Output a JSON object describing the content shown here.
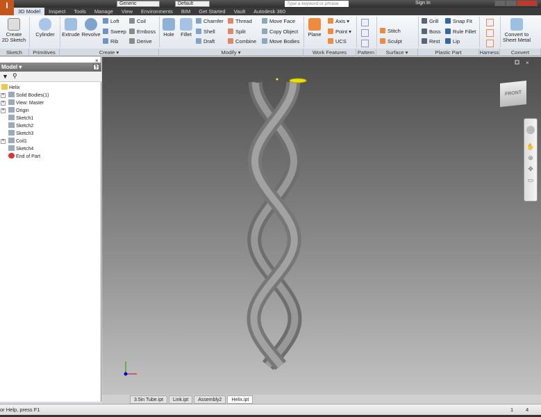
{
  "qat": {
    "material": "Generic",
    "appearance": "Default",
    "search_placeholder": "Type a keyword or phrase",
    "sign_in": "Sign In",
    "logo": "I",
    "logo_sub": "PRO"
  },
  "tabs": [
    "3D Model",
    "Inspect",
    "Tools",
    "Manage",
    "View",
    "Environments",
    "BIM",
    "Get Started",
    "Vault",
    "Autodesk 360"
  ],
  "ribbon": {
    "panels": [
      "Sketch",
      "Primitives",
      "Create ▾",
      "Modify ▾",
      "Work Features",
      "Pattern",
      "Surface ▾",
      "Plastic Part",
      "Harness",
      "Convert"
    ],
    "sketch": {
      "create": "Create",
      "create2": "2D Sketch"
    },
    "primitives": {
      "cylinder": "Cylinder"
    },
    "create": {
      "extrude": "Extrude",
      "revolve": "Revolve",
      "col1": [
        "Loft",
        "Sweep",
        "Rib"
      ],
      "col2": [
        "Coil",
        "Emboss",
        "Derive"
      ]
    },
    "modify": {
      "hole": "Hole",
      "fillet": "Fillet",
      "col1": [
        "Chamfer",
        "Shell",
        "Draft"
      ],
      "col2": [
        "Thread",
        "Split",
        "Combine"
      ],
      "col3": [
        "Move Face",
        "Copy Object",
        "Move Bodies"
      ]
    },
    "work": {
      "plane": "Plane",
      "items": [
        "Axis ▾",
        "Point ▾",
        "UCS"
      ]
    },
    "surface": {
      "items": [
        "Stitch",
        "Sculpt"
      ]
    },
    "plastic": {
      "col1": [
        "Grill",
        "Boss",
        "Rest"
      ],
      "col2": [
        "Snap Fit",
        "Rule Fillet",
        "Lip"
      ]
    },
    "convert": {
      "l1": "Convert to",
      "l2": "Sheet Metal"
    }
  },
  "browser": {
    "title": "Model ▾",
    "help": "?",
    "tree": [
      {
        "label": "Helix",
        "level": 0,
        "exp": false
      },
      {
        "label": "Solid Bodies(1)",
        "level": 1,
        "exp": true
      },
      {
        "label": "View: Master",
        "level": 1,
        "exp": true
      },
      {
        "label": "Origin",
        "level": 1,
        "exp": true
      },
      {
        "label": "Sketch1",
        "level": 1,
        "exp": false
      },
      {
        "label": "Sketch2",
        "level": 1,
        "exp": false
      },
      {
        "label": "Sketch3",
        "level": 1,
        "exp": false
      },
      {
        "label": "Coil1",
        "level": 1,
        "exp": true
      },
      {
        "label": "Sketch4",
        "level": 1,
        "exp": false
      },
      {
        "label": "End of Part",
        "level": 1,
        "exp": false
      }
    ]
  },
  "viewcube": "FRONT",
  "doc_tabs": [
    {
      "label": "3.5in Tube.ipt"
    },
    {
      "label": "Link.ipt"
    },
    {
      "label": "Assembly2"
    },
    {
      "label": "Helix.ipt",
      "active": true
    }
  ],
  "status": {
    "text": "or Help, press F1",
    "n1": "1",
    "n2": "4"
  },
  "colors": {
    "ribbon_accent": "#f08a3c",
    "viewport_top": "#4b4b4b",
    "viewport_bottom": "#c3c3c3",
    "model": "#8c8c8c"
  }
}
